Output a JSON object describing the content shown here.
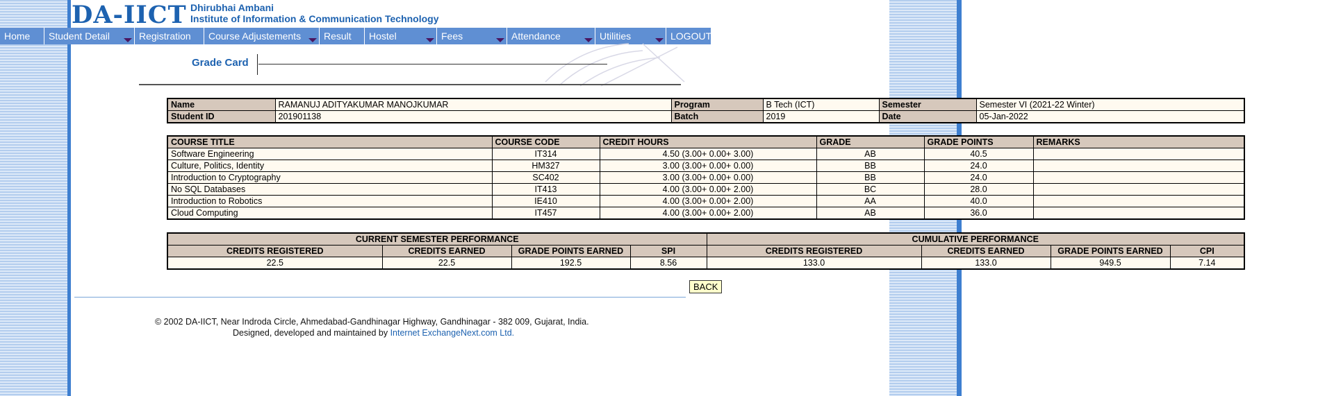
{
  "header": {
    "logo": "DA-IICT",
    "line1": "Dhirubhai Ambani",
    "line2": "Institute of Information & Communication Technology"
  },
  "nav": [
    {
      "label": "Home",
      "dropdown": false
    },
    {
      "label": "Student Detail",
      "dropdown": true
    },
    {
      "label": "Registration",
      "dropdown": false
    },
    {
      "label": "Course Adjustements",
      "dropdown": true
    },
    {
      "label": "Result",
      "dropdown": false
    },
    {
      "label": "Hostel",
      "dropdown": true
    },
    {
      "label": "Fees",
      "dropdown": true
    },
    {
      "label": "Attendance",
      "dropdown": true
    },
    {
      "label": "Utilities",
      "dropdown": true
    },
    {
      "label": "LOGOUT",
      "dropdown": false
    }
  ],
  "page_title": "Grade Card",
  "student": {
    "name_label": "Name",
    "name": "RAMANUJ ADITYAKUMAR MANOJKUMAR",
    "program_label": "Program",
    "program": "B Tech (ICT)",
    "semester_label": "Semester",
    "semester": "Semester VI (2021-22 Winter)",
    "id_label": "Student ID",
    "id": "201901138",
    "batch_label": "Batch",
    "batch": "2019",
    "date_label": "Date",
    "date": "05-Jan-2022"
  },
  "courses": {
    "headers": [
      "COURSE TITLE",
      "COURSE CODE",
      "CREDIT HOURS",
      "GRADE",
      "GRADE POINTS",
      "REMARKS"
    ],
    "rows": [
      {
        "title": "Software Engineering",
        "code": "IT314",
        "credits": "4.50 (3.00+ 0.00+ 3.00)",
        "grade": "AB",
        "points": "40.5",
        "remarks": ""
      },
      {
        "title": "Culture, Politics, Identity",
        "code": "HM327",
        "credits": "3.00 (3.00+ 0.00+ 0.00)",
        "grade": "BB",
        "points": "24.0",
        "remarks": ""
      },
      {
        "title": "Introduction to Cryptography",
        "code": "SC402",
        "credits": "3.00 (3.00+ 0.00+ 0.00)",
        "grade": "BB",
        "points": "24.0",
        "remarks": ""
      },
      {
        "title": "No SQL Databases",
        "code": "IT413",
        "credits": "4.00 (3.00+ 0.00+ 2.00)",
        "grade": "BC",
        "points": "28.0",
        "remarks": ""
      },
      {
        "title": "Introduction to Robotics",
        "code": "IE410",
        "credits": "4.00 (3.00+ 0.00+ 2.00)",
        "grade": "AA",
        "points": "40.0",
        "remarks": ""
      },
      {
        "title": "Cloud Computing",
        "code": "IT457",
        "credits": "4.00 (3.00+ 0.00+ 2.00)",
        "grade": "AB",
        "points": "36.0",
        "remarks": ""
      }
    ]
  },
  "performance": {
    "current_title": "CURRENT SEMESTER PERFORMANCE",
    "cumulative_title": "CUMULATIVE PERFORMANCE",
    "current_headers": [
      "CREDITS REGISTERED",
      "CREDITS EARNED",
      "GRADE POINTS EARNED",
      "SPI"
    ],
    "cumulative_headers": [
      "CREDITS REGISTERED",
      "CREDITS EARNED",
      "GRADE POINTS EARNED",
      "CPI"
    ],
    "current_values": [
      "22.5",
      "22.5",
      "192.5",
      "8.56"
    ],
    "cumulative_values": [
      "133.0",
      "133.0",
      "949.5",
      "7.14"
    ]
  },
  "back_label": "BACK",
  "footer": {
    "line1": "© 2002 DA-IICT, Near Indroda Circle, Ahmedabad-Gandhinagar Highway, Gandhinagar - 382 009, Gujarat, India.",
    "line2_prefix": "Designed, developed and maintained by",
    "link": "Internet ExchangeNext.com Ltd."
  },
  "colors": {
    "nav_bg": "#5f8fd3",
    "brand_blue": "#1d62b0",
    "label_bg": "#d6c8bc",
    "value_bg": "#fffaf0",
    "back_bg": "#ffffcc"
  }
}
